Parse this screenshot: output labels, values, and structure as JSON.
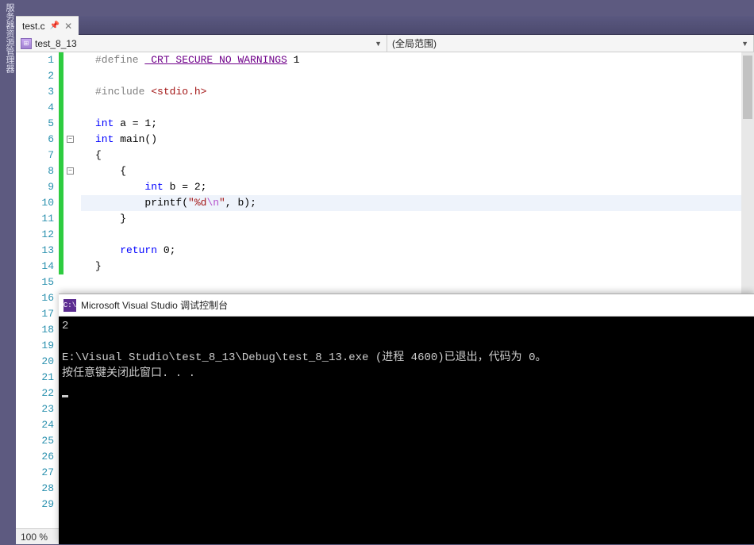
{
  "sidebar": {
    "label": "服务器资源管理器"
  },
  "tab": {
    "filename": "test.c"
  },
  "nav": {
    "left": "test_8_13",
    "right": "(全局范围)"
  },
  "zoom": "100 %",
  "code": {
    "lines": [
      {
        "n": 1,
        "segs": [
          {
            "t": "#define",
            "c": "def"
          },
          {
            "t": " ",
            "c": ""
          },
          {
            "t": "_CRT_SECURE_NO_WARNINGS",
            "c": "macro-u"
          },
          {
            "t": " 1",
            "c": "num"
          }
        ]
      },
      {
        "n": 2,
        "segs": []
      },
      {
        "n": 3,
        "segs": [
          {
            "t": "#include",
            "c": "def"
          },
          {
            "t": " ",
            "c": ""
          },
          {
            "t": "<stdio.h>",
            "c": "inc"
          }
        ]
      },
      {
        "n": 4,
        "segs": []
      },
      {
        "n": 5,
        "segs": [
          {
            "t": "int",
            "c": "kw"
          },
          {
            "t": " a = 1;",
            "c": "var"
          }
        ]
      },
      {
        "n": 6,
        "segs": [
          {
            "t": "int",
            "c": "kw"
          },
          {
            "t": " main()",
            "c": "fn"
          }
        ],
        "fold": true,
        "foldLeft": -18
      },
      {
        "n": 7,
        "segs": [
          {
            "t": "{",
            "c": "op"
          }
        ]
      },
      {
        "n": 8,
        "segs": [
          {
            "t": "    {",
            "c": "op"
          }
        ],
        "fold": true,
        "foldLeft": -18
      },
      {
        "n": 9,
        "segs": [
          {
            "t": "        ",
            "c": ""
          },
          {
            "t": "int",
            "c": "kw"
          },
          {
            "t": " b = 2;",
            "c": "var"
          }
        ]
      },
      {
        "n": 10,
        "segs": [
          {
            "t": "        printf(",
            "c": "fn"
          },
          {
            "t": "\"%d",
            "c": "str"
          },
          {
            "t": "\\n",
            "c": "esc"
          },
          {
            "t": "\"",
            "c": "str"
          },
          {
            "t": ", b);",
            "c": "op"
          }
        ],
        "current": true
      },
      {
        "n": 11,
        "segs": [
          {
            "t": "    }",
            "c": "op"
          }
        ]
      },
      {
        "n": 12,
        "segs": []
      },
      {
        "n": 13,
        "segs": [
          {
            "t": "    ",
            "c": ""
          },
          {
            "t": "return",
            "c": "kw"
          },
          {
            "t": " 0;",
            "c": "num"
          }
        ]
      },
      {
        "n": 14,
        "segs": [
          {
            "t": "}",
            "c": "op"
          }
        ]
      },
      {
        "n": 15,
        "segs": []
      },
      {
        "n": 16,
        "segs": []
      },
      {
        "n": 17,
        "segs": []
      },
      {
        "n": 18,
        "segs": []
      },
      {
        "n": 19,
        "segs": []
      },
      {
        "n": 20,
        "segs": []
      },
      {
        "n": 21,
        "segs": []
      },
      {
        "n": 22,
        "segs": []
      },
      {
        "n": 23,
        "segs": []
      },
      {
        "n": 24,
        "segs": []
      },
      {
        "n": 25,
        "segs": []
      },
      {
        "n": 26,
        "segs": []
      },
      {
        "n": 27,
        "segs": []
      },
      {
        "n": 28,
        "segs": []
      },
      {
        "n": 29,
        "segs": []
      }
    ],
    "change_bar": {
      "from": 1,
      "to": 14
    }
  },
  "console": {
    "title": "Microsoft Visual Studio 调试控制台",
    "lines": [
      "2",
      "",
      "E:\\Visual Studio\\test_8_13\\Debug\\test_8_13.exe (进程 4600)已退出，代码为 0。",
      "按任意键关闭此窗口. . ."
    ]
  }
}
